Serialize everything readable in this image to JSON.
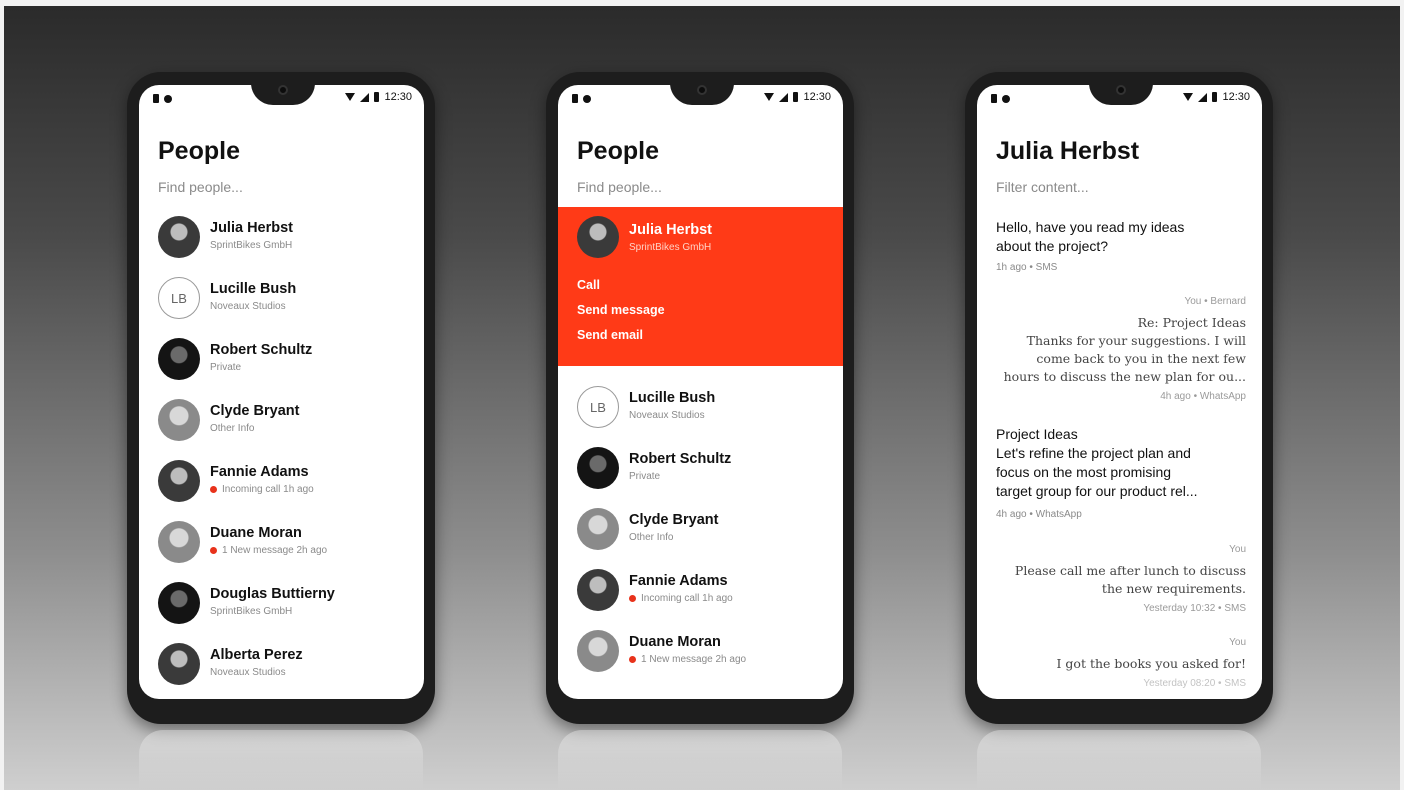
{
  "status_time": "12:30",
  "phone1": {
    "title": "People",
    "search_placeholder": "Find people...",
    "people": [
      {
        "name": "Julia Herbst",
        "sub": "SprintBikes GmbH",
        "alert": false
      },
      {
        "name": "Lucille Bush",
        "sub": "Noveaux Studios",
        "initials": "LB",
        "alert": false
      },
      {
        "name": "Robert Schultz",
        "sub": "Private",
        "alert": false
      },
      {
        "name": "Clyde Bryant",
        "sub": "Other Info",
        "alert": false
      },
      {
        "name": "Fannie Adams",
        "sub": "Incoming call 1h ago",
        "alert": true
      },
      {
        "name": "Duane Moran",
        "sub": "1 New message 2h ago",
        "alert": true
      },
      {
        "name": "Douglas Buttierny",
        "sub": "SprintBikes GmbH",
        "alert": false
      },
      {
        "name": "Alberta Perez",
        "sub": "Noveaux Studios",
        "alert": false
      }
    ]
  },
  "phone2": {
    "title": "People",
    "search_placeholder": "Find people...",
    "expanded": {
      "name": "Julia Herbst",
      "sub": "SprintBikes GmbH",
      "actions": [
        "Call",
        "Send message",
        "Send email"
      ]
    },
    "people": [
      {
        "name": "Lucille Bush",
        "sub": "Noveaux Studios",
        "initials": "LB",
        "alert": false
      },
      {
        "name": "Robert Schultz",
        "sub": "Private",
        "alert": false
      },
      {
        "name": "Clyde Bryant",
        "sub": "Other Info",
        "alert": false
      },
      {
        "name": "Fannie Adams",
        "sub": "Incoming call 1h ago",
        "alert": true
      },
      {
        "name": "Duane Moran",
        "sub": "1 New message 2h ago",
        "alert": true
      }
    ]
  },
  "phone3": {
    "title": "Julia Herbst",
    "filter_placeholder": "Filter content...",
    "messages": [
      {
        "side": "left",
        "lines": [
          "Hello, have you read my ideas",
          "about the project?"
        ],
        "meta": "1h ago • SMS"
      },
      {
        "side": "right",
        "header": "You • Bernard",
        "lines": [
          "Re: Project Ideas",
          "Thanks for your suggestions. I will",
          "come back to you in the next few",
          "hours to discuss the new plan for ou..."
        ],
        "meta": "4h ago • WhatsApp"
      },
      {
        "side": "left",
        "lines": [
          "Project Ideas",
          "Let's refine the project plan and",
          "focus on the most promising",
          "target group for our product rel..."
        ],
        "meta": "4h ago • WhatsApp"
      },
      {
        "side": "right",
        "header": "You",
        "lines": [
          "Please call me after lunch to discuss",
          "the new requirements."
        ],
        "meta": "Yesterday 10:32 •  SMS"
      },
      {
        "side": "right",
        "header": "You",
        "lines": [
          "I got the  books you asked for!"
        ],
        "meta": "Yesterday 08:20 •  SMS"
      }
    ]
  }
}
